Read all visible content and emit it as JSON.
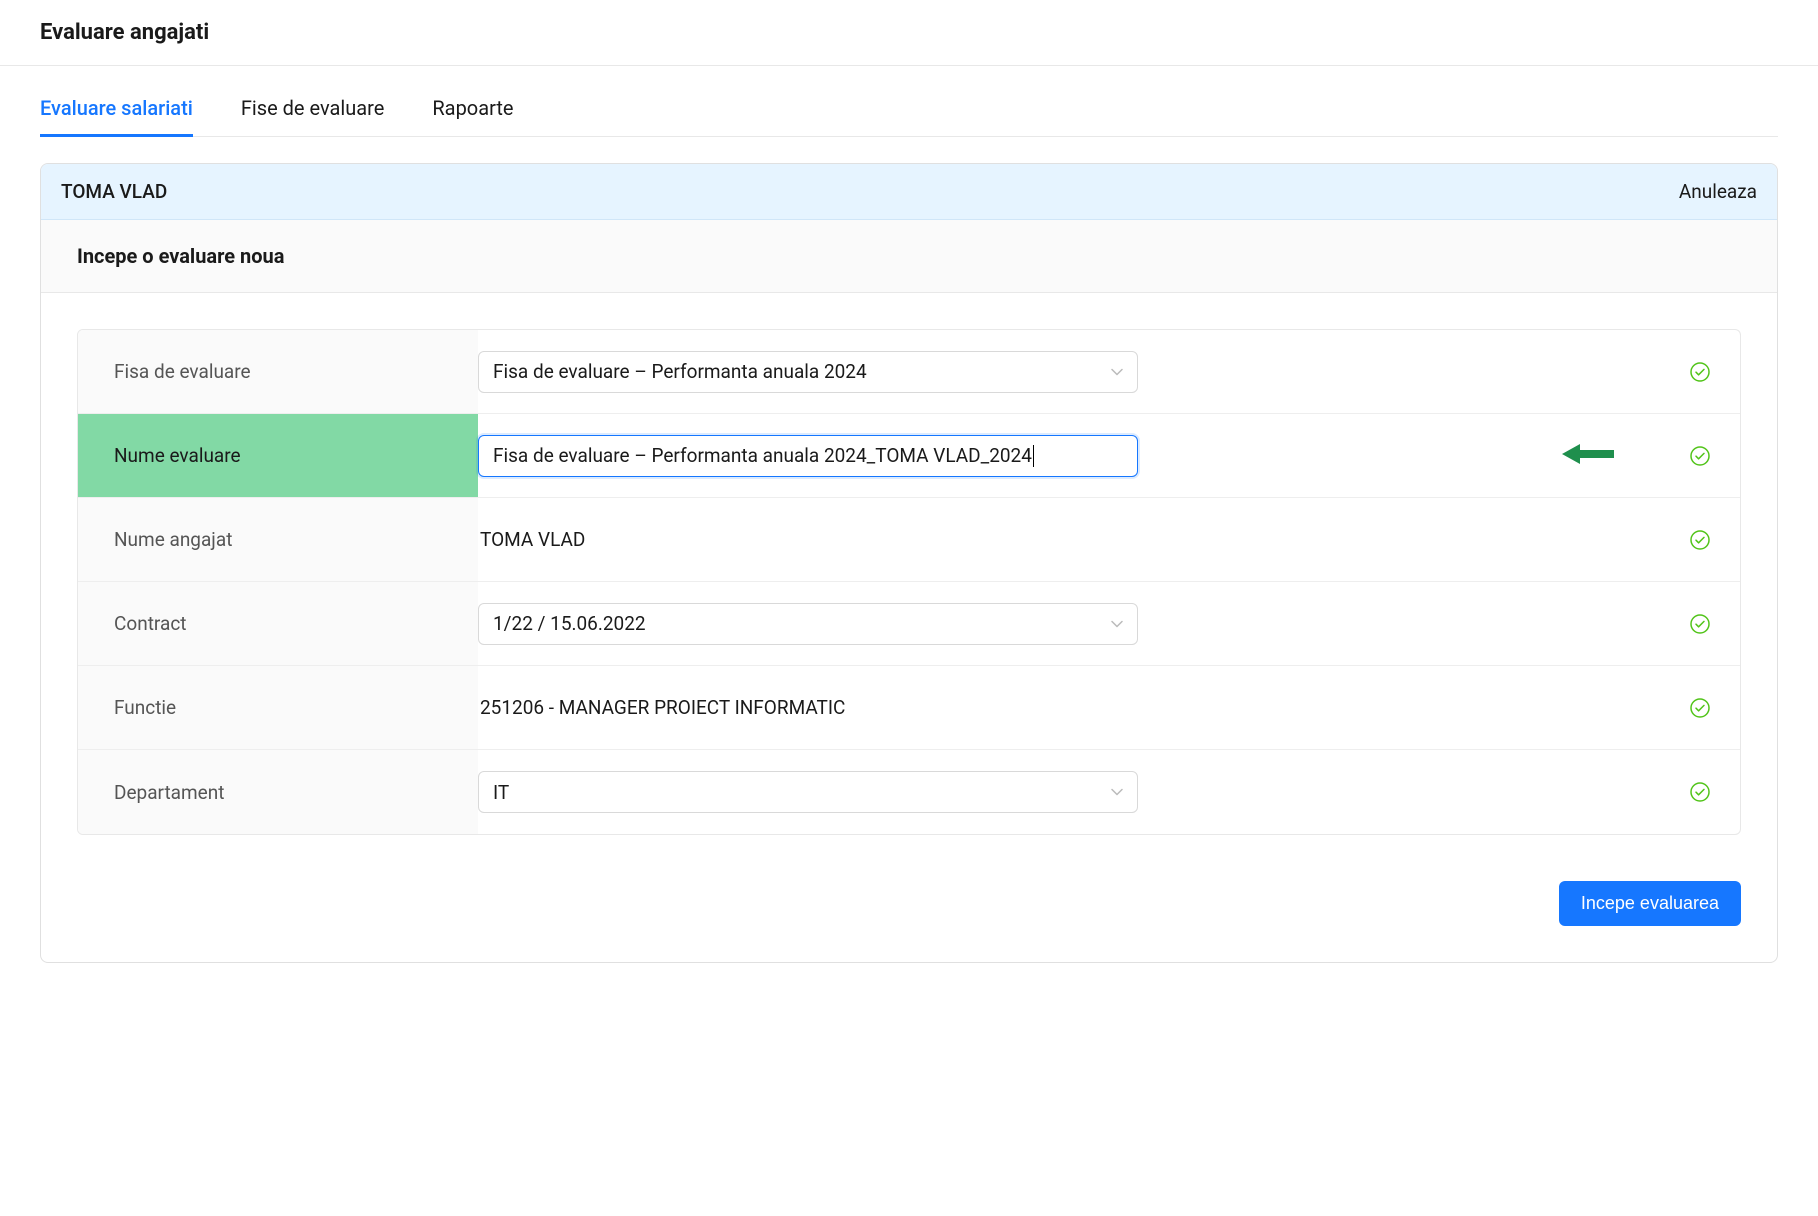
{
  "header": {
    "title": "Evaluare angajati"
  },
  "tabs": {
    "evaluare_salariati": "Evaluare salariati",
    "fise_de_evaluare": "Fise de evaluare",
    "rapoarte": "Rapoarte"
  },
  "panel": {
    "employee_name": "TOMA VLAD",
    "cancel_label": "Anuleaza",
    "section_title": "Incepe o evaluare noua"
  },
  "form": {
    "fisa": {
      "label": "Fisa de evaluare",
      "value": "Fisa de evaluare – Performanta anuala 2024"
    },
    "nume_evaluare": {
      "label": "Nume evaluare",
      "value": "Fisa de evaluare – Performanta anuala 2024_TOMA VLAD_2024"
    },
    "nume_angajat": {
      "label": "Nume angajat",
      "value": "TOMA VLAD"
    },
    "contract": {
      "label": "Contract",
      "value": "1/22 / 15.06.2022"
    },
    "functie": {
      "label": "Functie",
      "value": "251206 - MANAGER PROIECT INFORMATIC"
    },
    "departament": {
      "label": "Departament",
      "value": "IT"
    }
  },
  "actions": {
    "incepe": "Incepe evaluarea"
  },
  "colors": {
    "accent": "#1677ff",
    "highlight": "#82d9a5",
    "success": "#52c41a",
    "arrow": "#1f8f4d"
  }
}
